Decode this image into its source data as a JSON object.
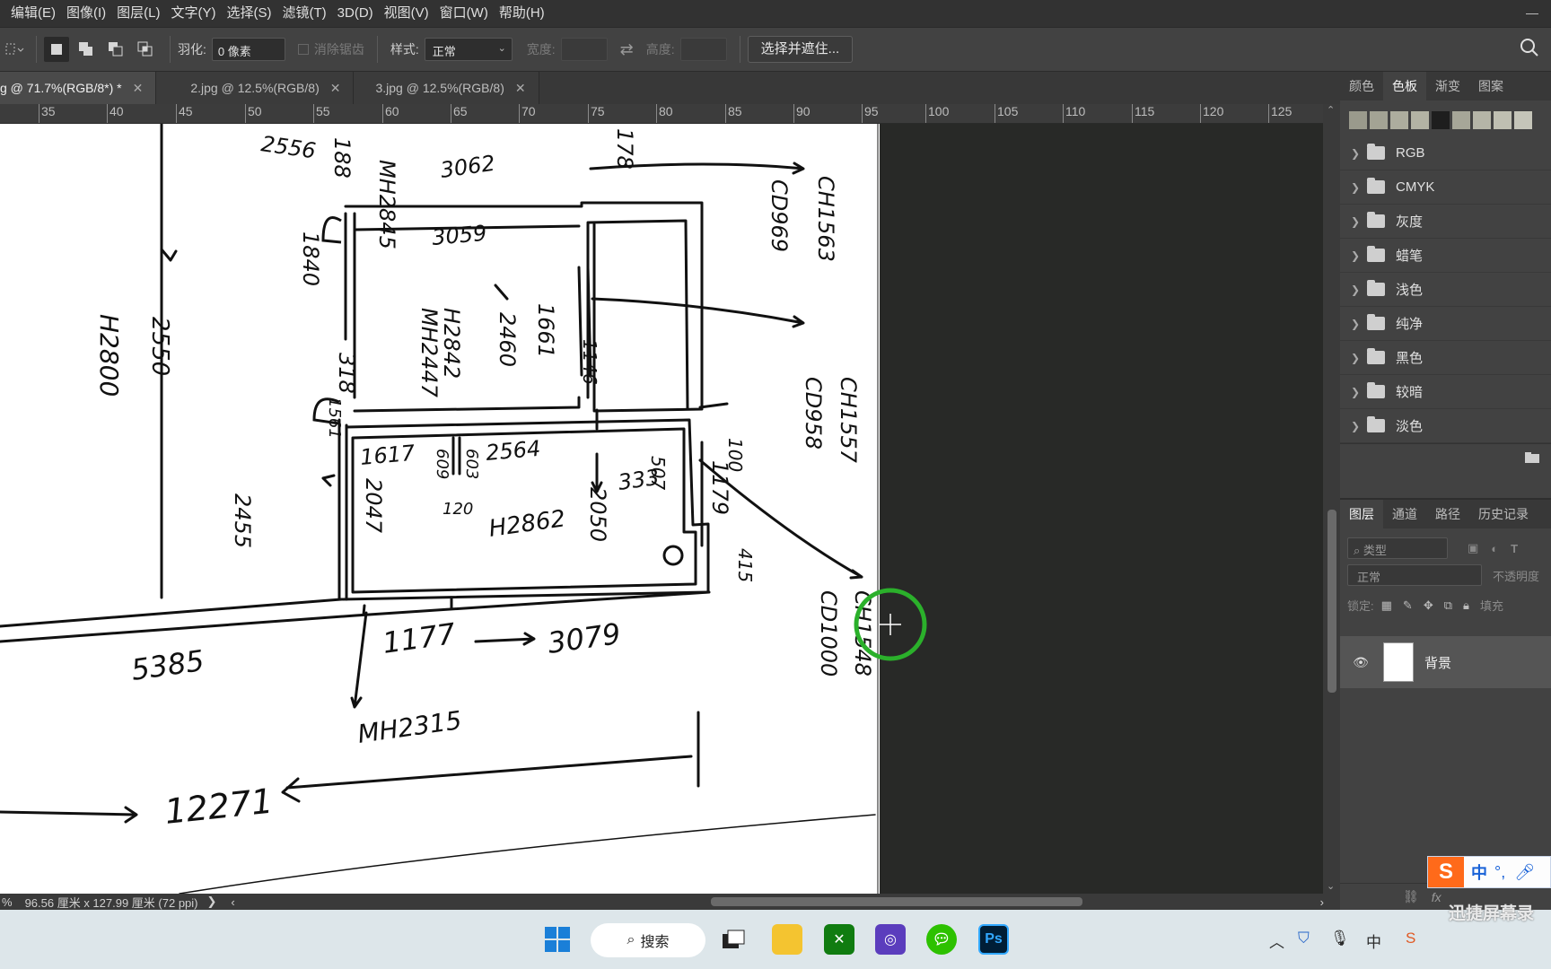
{
  "menubar": {
    "items": [
      "编辑(E)",
      "图像(I)",
      "图层(L)",
      "文字(Y)",
      "选择(S)",
      "滤镜(T)",
      "3D(D)",
      "视图(V)",
      "窗口(W)",
      "帮助(H)"
    ]
  },
  "options": {
    "feather_label": "羽化:",
    "feather_value": "0 像素",
    "antialias_label": "消除锯齿",
    "style_label": "样式:",
    "style_value": "正常",
    "width_label": "宽度:",
    "height_label": "高度:",
    "select_mask_button": "选择并遮住..."
  },
  "tabs": [
    {
      "label": "g @ 71.7%(RGB/8*) *",
      "active": true
    },
    {
      "label": "2.jpg @ 12.5%(RGB/8)",
      "active": false
    },
    {
      "label": "3.jpg @ 12.5%(RGB/8)",
      "active": false
    }
  ],
  "ruler": {
    "labels": [
      "35",
      "40",
      "45",
      "50",
      "55",
      "60",
      "65",
      "70",
      "75",
      "80",
      "85",
      "90",
      "95",
      "100",
      "105",
      "110",
      "115",
      "120",
      "125"
    ]
  },
  "status": {
    "zoom_prefix": "%",
    "doc_size": "96.56 厘米 x 127.99 厘米 (72 ppi)",
    "arrow": "❯",
    "nav_left": "‹",
    "nav_right": "›"
  },
  "swatches_panel": {
    "tabs": [
      "颜色",
      "色板",
      "渐变",
      "图案"
    ],
    "active_tab": "色板",
    "swatch_colors": [
      "#9a9a8c",
      "#a3a394",
      "#adad9e",
      "#b3b3a4",
      "#1e1e1e",
      "#a6a698",
      "#b5b5a7",
      "#bfbfb2",
      "#c5c5b9"
    ],
    "groups": [
      "RGB",
      "CMYK",
      "灰度",
      "蜡笔",
      "浅色",
      "纯净",
      "黑色",
      "较暗",
      "淡色"
    ]
  },
  "layers_panel": {
    "tabs": [
      "图层",
      "通道",
      "路径",
      "历史记录"
    ],
    "active_tab": "图层",
    "filter_kind": "类型",
    "blend_mode": "正常",
    "opacity_label": "不透明度",
    "lock_label": "锁定:",
    "fill_label": "填充",
    "layers": [
      {
        "name": "背景",
        "visible": true
      }
    ]
  },
  "taskbar": {
    "search_label": "搜索",
    "input_method": "中"
  },
  "ime": {
    "mode": "中",
    "punct": "°,"
  },
  "watermark": {
    "text": "迅捷屏幕录"
  },
  "drawing": {
    "labels": [
      "2556",
      "3062",
      "MH2845",
      "3059",
      "H2842",
      "2460",
      "MH2447",
      "1840",
      "1661",
      "1617",
      "609",
      "603",
      "2564",
      "507",
      "333",
      "100",
      "1179",
      "H2862",
      "2047",
      "2050",
      "120",
      "2455",
      "H2800",
      "2550",
      "CH1563",
      "CD969",
      "CH1557",
      "CD958",
      "CH1548",
      "CD1000",
      "415",
      "5385",
      "1177",
      "3079",
      "MH2315",
      "12271",
      "188",
      "178",
      "318",
      "1146",
      "1561"
    ]
  },
  "colors": {
    "menubar_bg": "#323232",
    "panel_bg": "#424242",
    "canvas_bg": "#282927",
    "cursor_ring": "#2bb02b"
  }
}
